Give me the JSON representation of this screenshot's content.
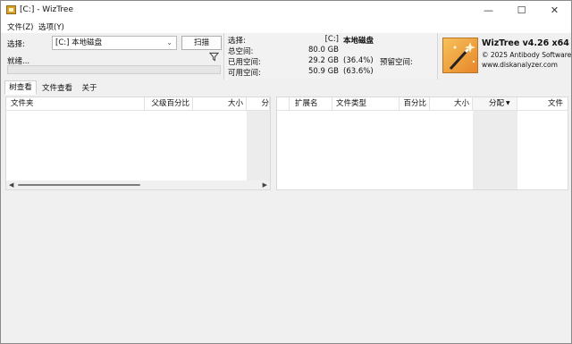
{
  "window": {
    "title": "[C:]  - WizTree",
    "minimize": "—",
    "maximize": "☐",
    "close": "✕"
  },
  "menu": {
    "file": "文件(Z)",
    "options": "选项(Y)"
  },
  "scan": {
    "select_label": "选择:",
    "drive_value": "[C:] 本地磁盘",
    "scan_button": "扫描",
    "status": "就绪...",
    "progress_fraction": 0
  },
  "drive_info": {
    "select_label": "选择:",
    "drive_letter": "[C:]",
    "drive_name": "本地磁盘",
    "total_label": "总空间:",
    "total_value": "80.0 GB",
    "used_label": "已用空间:",
    "used_value": "29.2 GB",
    "used_pct": "(36.4%)",
    "reserved_label": "预留空间:",
    "free_label": "可用空间:",
    "free_value": "50.9 GB",
    "free_pct": "(63.6%)"
  },
  "brand": {
    "product": "WizTree v4.26 x64",
    "copyright": "© 2025 Antibody Software",
    "website": "www.diskanalyzer.com"
  },
  "tabs": [
    "树查看",
    "文件查看",
    "关于"
  ],
  "tree_columns": [
    "文件夹",
    "父级百分比",
    "大小",
    "分"
  ],
  "type_columns": [
    "扩展名",
    "文件类型",
    "百分比",
    "大小",
    "分配",
    "文件"
  ],
  "colors": {
    "progress_green": "#06b025"
  }
}
